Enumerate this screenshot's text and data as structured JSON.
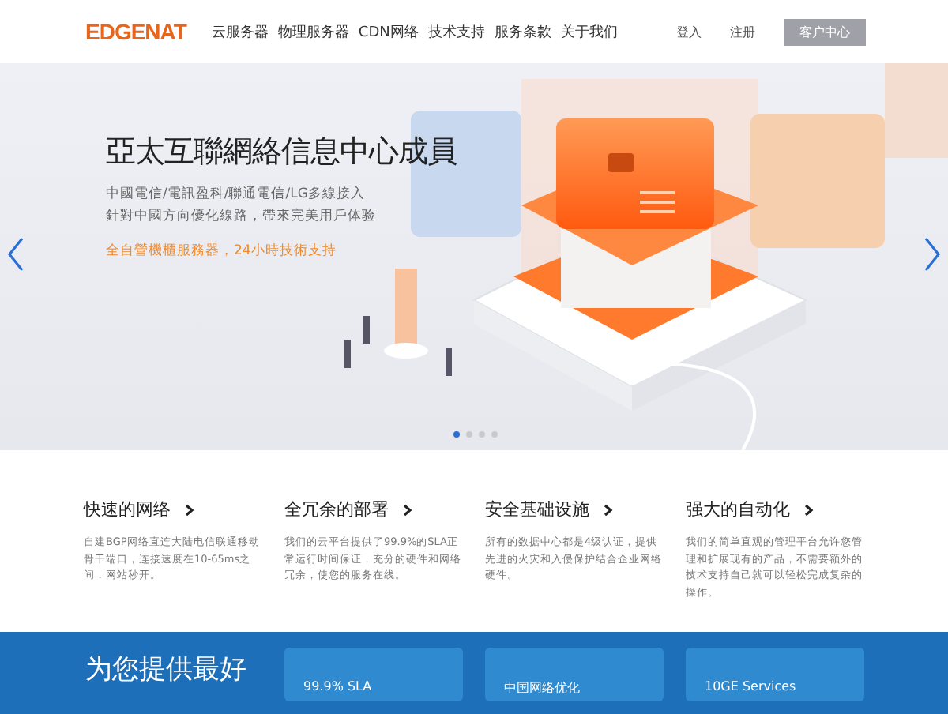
{
  "header": {
    "logo": "EDGENAT",
    "nav": [
      {
        "label": "云服务器",
        "selected": false
      },
      {
        "label": "物理服务器",
        "selected": false
      },
      {
        "label": "CDN网络",
        "selected": false
      },
      {
        "label": "技术支持",
        "selected": false
      },
      {
        "label": "服务条款",
        "selected": false
      },
      {
        "label": "关于我们",
        "selected": false
      }
    ],
    "login": "登入",
    "register": "注册",
    "client_center": "客户中心"
  },
  "hero": {
    "title": "亞太互聯網絡信息中心成員",
    "lines": [
      "中國電信/電訊盈科/聯通電信/LG多線接入",
      "針對中國方向優化線路，帶來完美用戶体验"
    ],
    "highlight": "全自營機櫃服務器，24小時技術支持",
    "slides": [
      {
        "selected": true
      },
      {
        "selected": false
      },
      {
        "selected": false
      },
      {
        "selected": false
      }
    ]
  },
  "features": [
    {
      "title": "快速的网络",
      "text": "自建BGP网络直连大陆电信联通移动骨干端口，连接速度在10-65ms之间，网站秒开。"
    },
    {
      "title": "全冗余的部署",
      "text": "我们的云平台提供了99.9%的SLA正常运行时间保证，充分的硬件和网络冗余，使您的服务在线。"
    },
    {
      "title": "安全基础设施",
      "text": "所有的数据中心都是4级认证，提供先进的火灾和入侵保护结合企业网络硬件。"
    },
    {
      "title": "强大的自动化",
      "text": "我们的简单直观的管理平台允许您管理和扩展现有的产品，不需要额外的技术支持自己就可以轻松完成复杂的操作。"
    }
  ],
  "offer": {
    "heading": "为您提供最好",
    "cards": [
      "99.9% SLA",
      "中国网络优化",
      "10GE Services"
    ]
  }
}
